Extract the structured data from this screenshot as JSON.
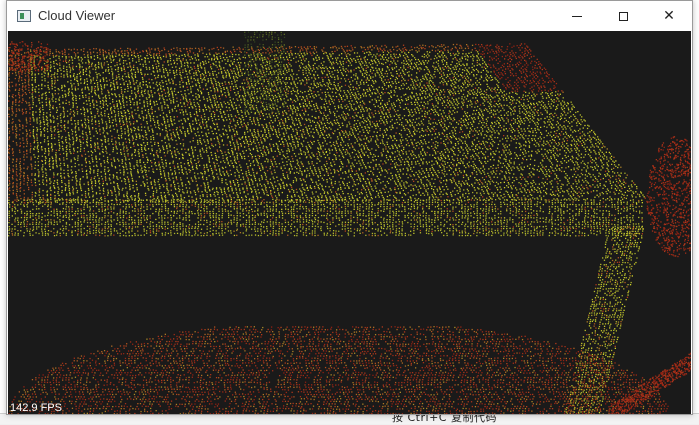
{
  "window": {
    "title": "Cloud Viewer",
    "controls": {
      "minimize": "minimize",
      "maximize": "maximize",
      "close": "close"
    }
  },
  "viewer": {
    "fps_label": "142.9 FPS",
    "colors": {
      "background": "#1a1a1a",
      "near": "#d4d42a",
      "mid": "#a8b02c",
      "far": "#b23a1c",
      "deep": "#8a1e12"
    }
  },
  "background_app": {
    "bottom_text": "按 Ctrl+C 复制代码"
  }
}
